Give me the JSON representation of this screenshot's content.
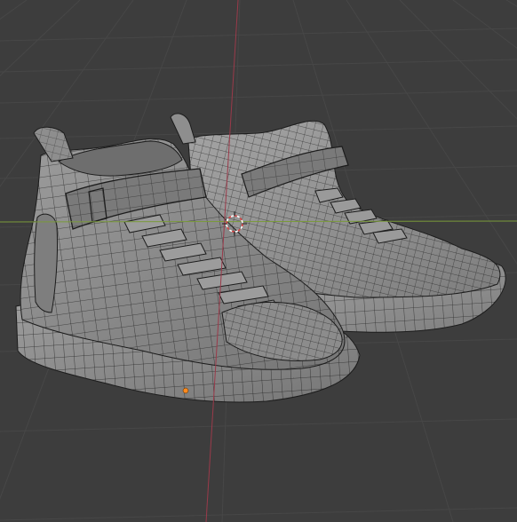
{
  "viewport": {
    "mode": "3d-viewport",
    "shading": "solid-wireframe",
    "colors": {
      "background": "#3d3d3d",
      "grid_line": "#474747",
      "x_axis": "#7a9a3a",
      "y_axis": "#9a3a4a",
      "mesh_fill": "#8a8a8a",
      "mesh_shade": "#6c6c6c",
      "mesh_light": "#a2a2a2",
      "wire": "#1c1c1c",
      "cursor_ring": "#d84040",
      "origin_dot": "#ff8a1e"
    },
    "objects": [
      {
        "name": "sneaker-left"
      },
      {
        "name": "sneaker-right"
      }
    ],
    "icons": [
      "3d-cursor-icon",
      "origin-point-icon"
    ]
  }
}
